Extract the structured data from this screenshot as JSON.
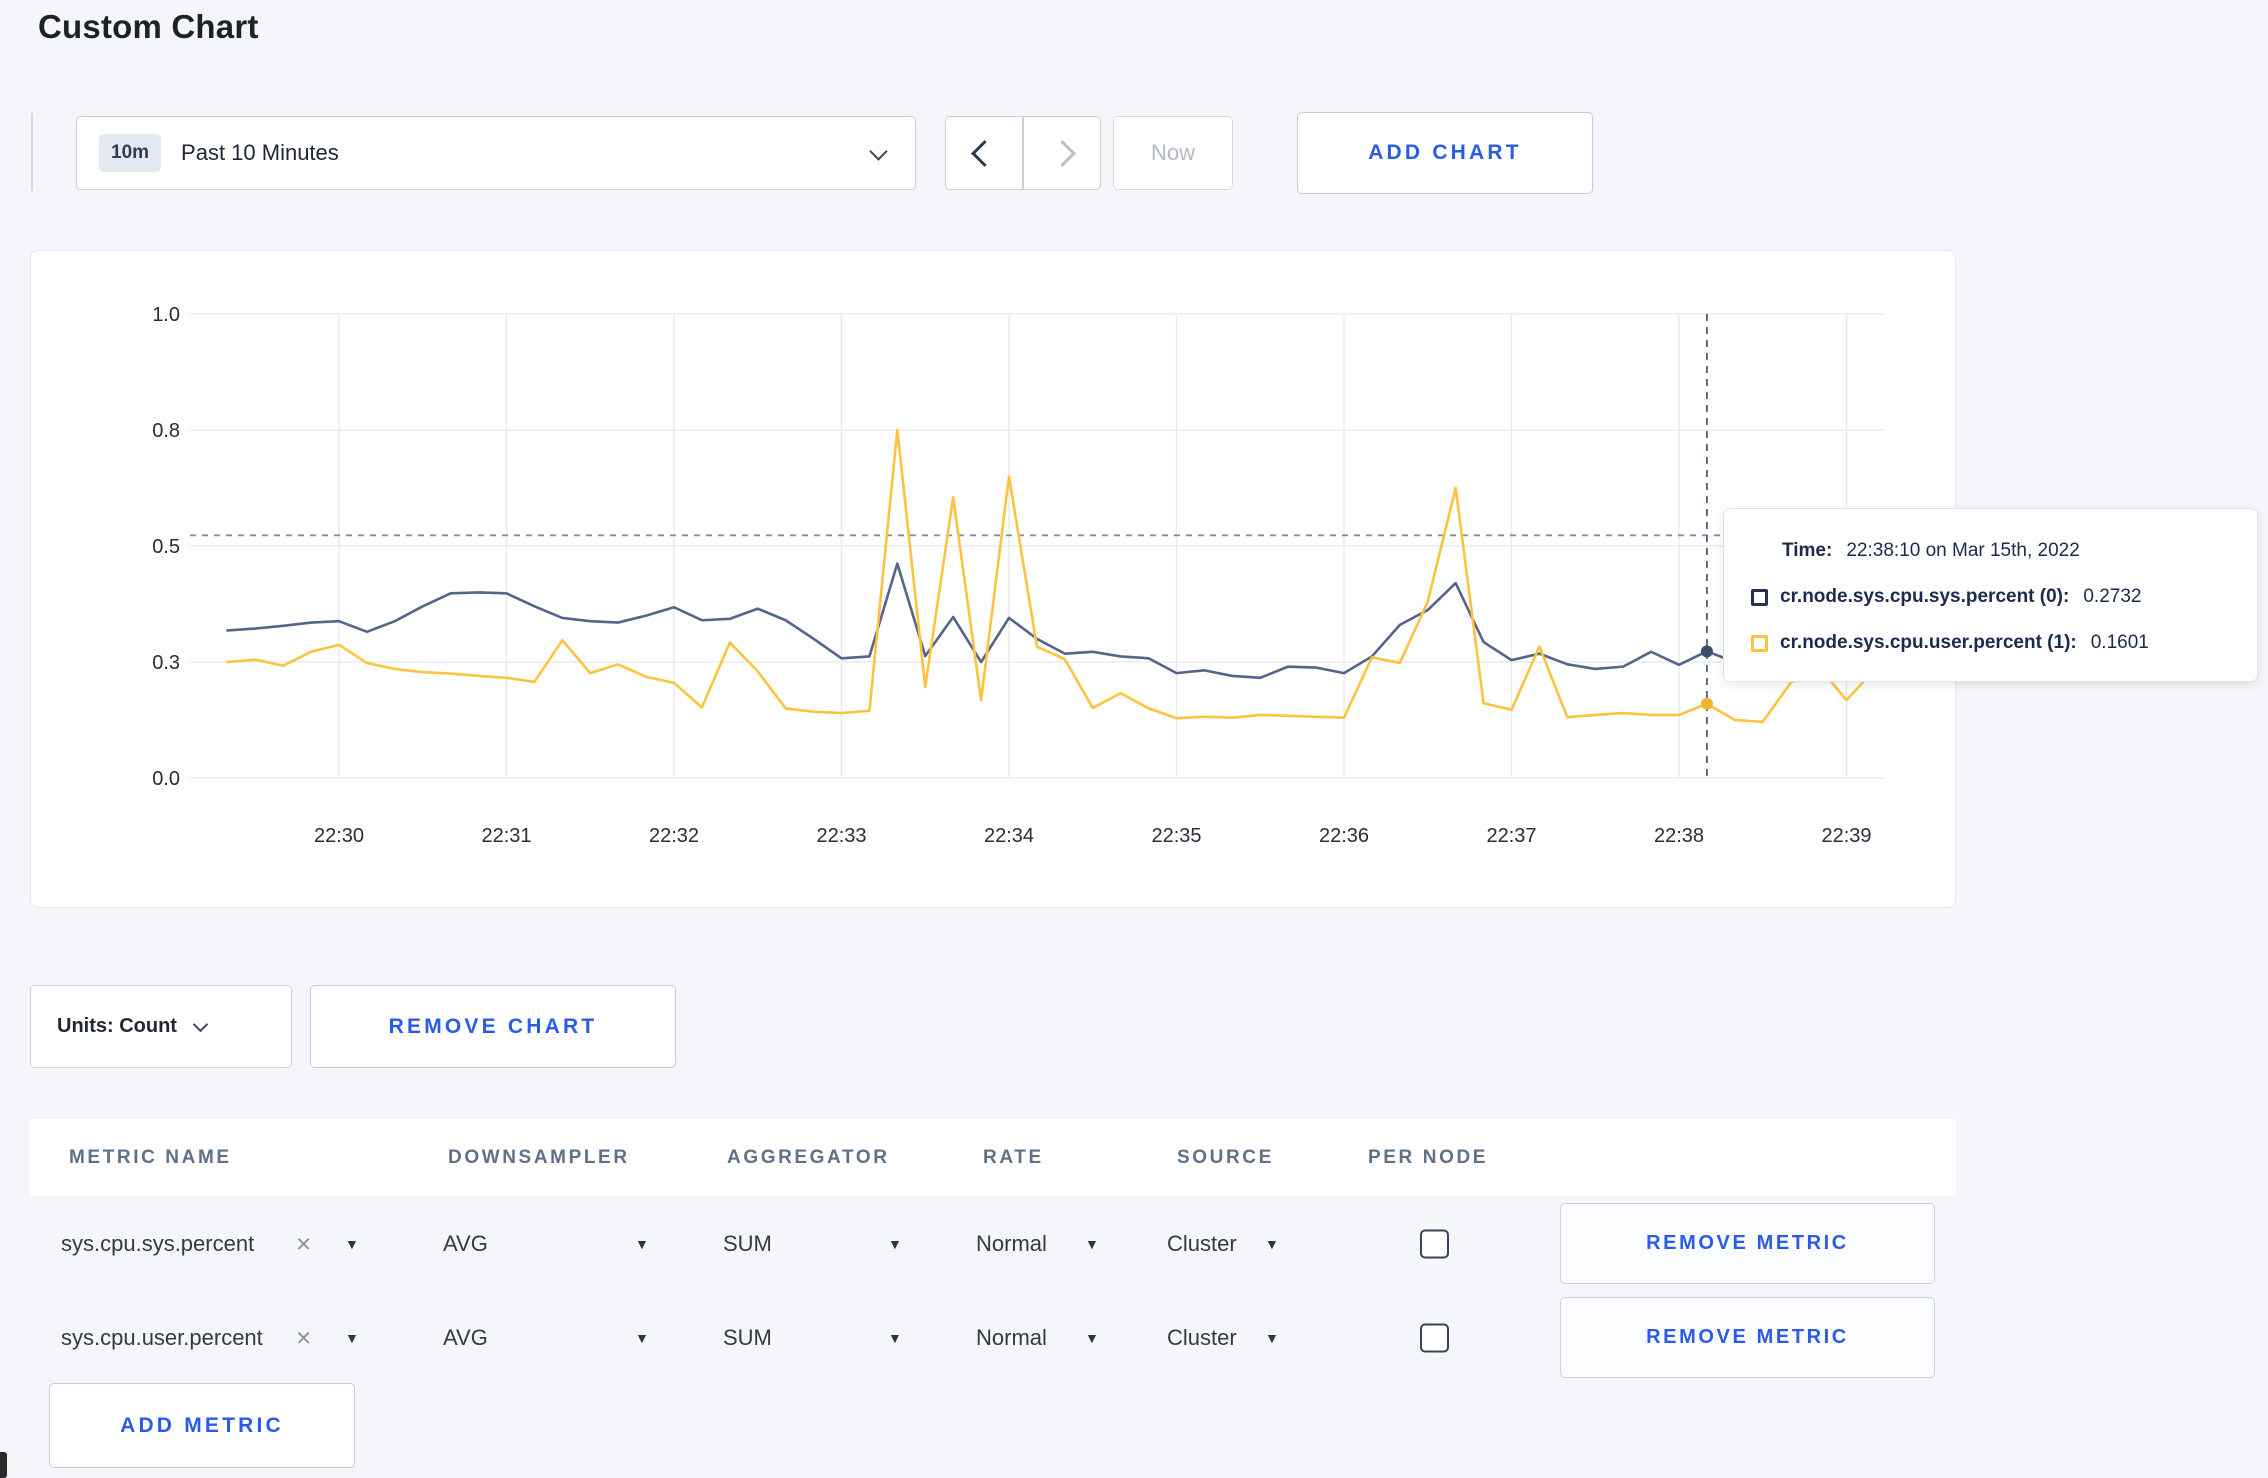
{
  "page": {
    "title": "Custom Chart"
  },
  "toolbar": {
    "time_badge": "10m",
    "time_label": "Past 10 Minutes",
    "now_label": "Now",
    "add_chart_label": "ADD CHART"
  },
  "colors": {
    "accent_blue": "#2a5ce6",
    "series_sys": "#54658a",
    "series_user": "#fdc33e",
    "page_bg": "#f4f6f9"
  },
  "chart_data": {
    "type": "line",
    "title": "",
    "xlabel": "",
    "ylabel": "",
    "ylim": [
      0,
      1
    ],
    "grid": true,
    "x_start": "22:29:20",
    "x_step_seconds": 10,
    "x_ticks": [
      "22:30",
      "22:31",
      "22:32",
      "22:33",
      "22:34",
      "22:35",
      "22:36",
      "22:37",
      "22:38",
      "22:39"
    ],
    "y_ticks": {
      "values": [
        0,
        0.25,
        0.5,
        0.75,
        1.0
      ],
      "labels": [
        "0.0",
        "0.3",
        "0.5",
        "0.8",
        "1.0"
      ]
    },
    "hover_time": "22:38:10",
    "hover_guide_value": 0.523,
    "legend_position": "tooltip",
    "series": [
      {
        "name": "cr.node.sys.cpu.sys.percent (0)",
        "color": "#54658a",
        "values": [
          0.318,
          0.322,
          0.328,
          0.335,
          0.338,
          0.315,
          0.338,
          0.37,
          0.398,
          0.4,
          0.398,
          0.37,
          0.345,
          0.338,
          0.335,
          0.35,
          0.368,
          0.34,
          0.343,
          0.365,
          0.34,
          0.3,
          0.258,
          0.262,
          0.462,
          0.263,
          0.347,
          0.25,
          0.345,
          0.3,
          0.268,
          0.272,
          0.262,
          0.258,
          0.226,
          0.232,
          0.22,
          0.216,
          0.24,
          0.238,
          0.226,
          0.262,
          0.33,
          0.362,
          0.42,
          0.293,
          0.254,
          0.268,
          0.245,
          0.235,
          0.24,
          0.272,
          0.244,
          0.273,
          0.25,
          0.252,
          0.256,
          0.258,
          0.252,
          0.25
        ]
      },
      {
        "name": "cr.node.sys.cpu.user.percent (1)",
        "color": "#fdc33e",
        "values": [
          0.25,
          0.255,
          0.242,
          0.272,
          0.287,
          0.248,
          0.235,
          0.228,
          0.225,
          0.22,
          0.216,
          0.207,
          0.297,
          0.226,
          0.245,
          0.218,
          0.205,
          0.152,
          0.292,
          0.23,
          0.15,
          0.143,
          0.14,
          0.145,
          0.75,
          0.196,
          0.605,
          0.168,
          0.65,
          0.283,
          0.256,
          0.151,
          0.183,
          0.15,
          0.129,
          0.132,
          0.13,
          0.136,
          0.134,
          0.132,
          0.13,
          0.26,
          0.248,
          0.38,
          0.625,
          0.161,
          0.147,
          0.283,
          0.131,
          0.136,
          0.14,
          0.136,
          0.136,
          0.16,
          0.125,
          0.121,
          0.205,
          0.24,
          0.168,
          0.233
        ]
      }
    ]
  },
  "tooltip": {
    "time_label": "Time:",
    "time_value": "22:38:10 on Mar 15th, 2022",
    "series": [
      {
        "label": "cr.node.sys.cpu.sys.percent (0):",
        "value": "0.2732",
        "color": "#24314f"
      },
      {
        "label": "cr.node.sys.cpu.user.percent (1):",
        "value": "0.1601",
        "color": "#fdc33e"
      }
    ]
  },
  "units": {
    "label": "Units: Count"
  },
  "chart_actions": {
    "remove_chart_label": "REMOVE CHART"
  },
  "table": {
    "headers": [
      "METRIC NAME",
      "DOWNSAMPLER",
      "AGGREGATOR",
      "RATE",
      "SOURCE",
      "PER NODE"
    ],
    "remove_metric_label": "REMOVE METRIC",
    "add_metric_label": "ADD METRIC",
    "rows": [
      {
        "metric": "sys.cpu.sys.percent",
        "downsampler": "AVG",
        "aggregator": "SUM",
        "rate": "Normal",
        "source": "Cluster",
        "per_node": false
      },
      {
        "metric": "sys.cpu.user.percent",
        "downsampler": "AVG",
        "aggregator": "SUM",
        "rate": "Normal",
        "source": "Cluster",
        "per_node": false
      }
    ]
  }
}
